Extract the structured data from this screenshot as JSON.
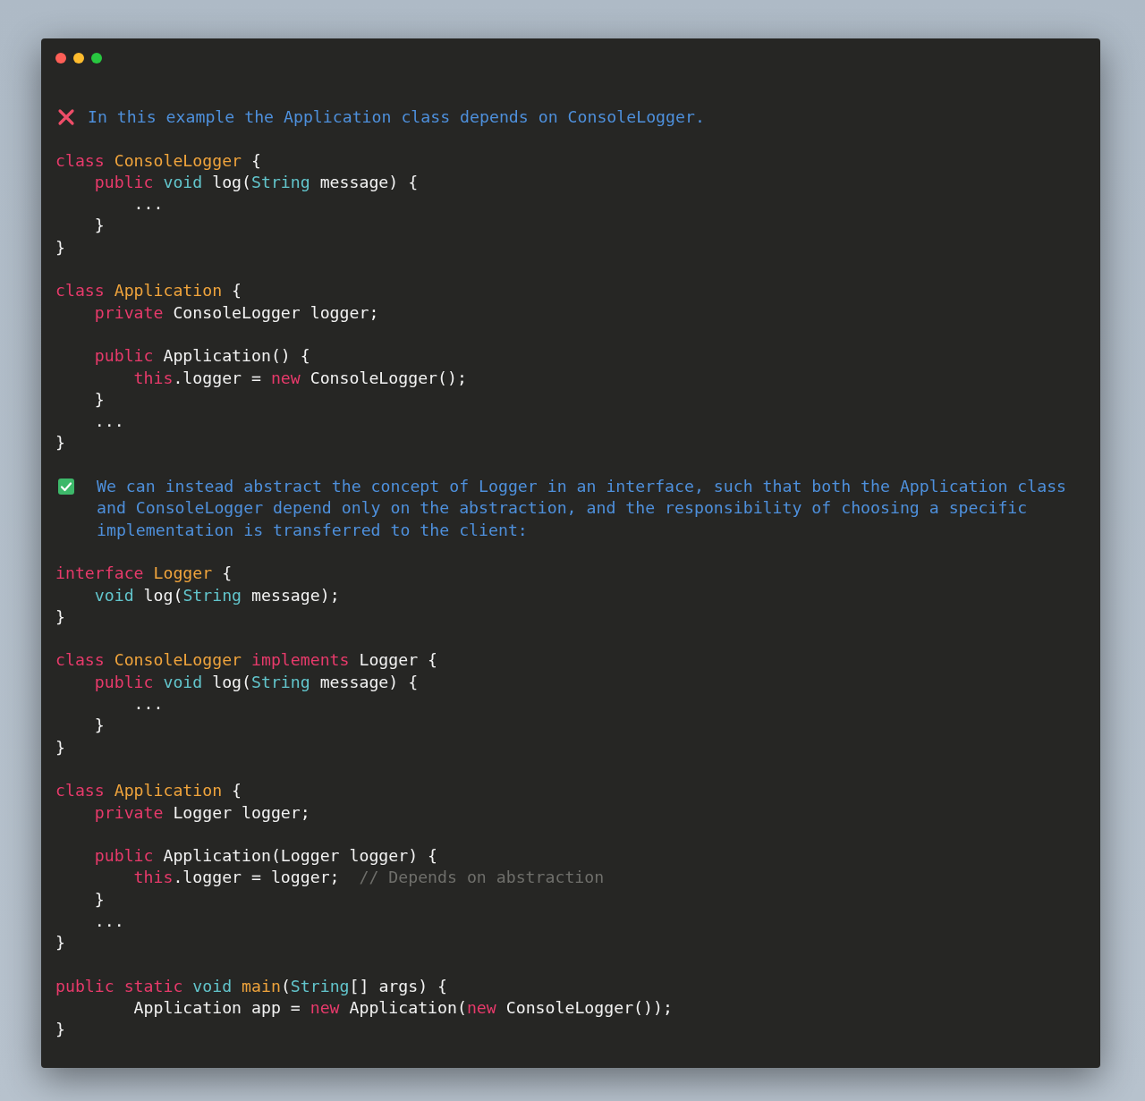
{
  "blocks": [
    {
      "kind": "error-note",
      "text": "In this example the Application class depends on ConsoleLogger."
    },
    {
      "kind": "code",
      "lines": [
        {
          "tokens": [
            {
              "kind": "keyword",
              "text": "class "
            },
            {
              "kind": "type",
              "text": "ConsoleLogger"
            },
            {
              "kind": "plain",
              "text": " {"
            }
          ]
        },
        {
          "tokens": [
            {
              "kind": "keyword",
              "text": "    public "
            },
            {
              "kind": "builtin",
              "text": "void "
            },
            {
              "kind": "plain",
              "text": "log("
            },
            {
              "kind": "builtin",
              "text": "String"
            },
            {
              "kind": "plain",
              "text": " message) {"
            }
          ]
        },
        {
          "tokens": [
            {
              "kind": "plain",
              "text": "        ..."
            }
          ]
        },
        {
          "tokens": [
            {
              "kind": "plain",
              "text": "    }"
            }
          ]
        },
        {
          "tokens": [
            {
              "kind": "plain",
              "text": "}"
            }
          ]
        }
      ]
    },
    {
      "kind": "code",
      "lines": [
        {
          "tokens": [
            {
              "kind": "keyword",
              "text": "class "
            },
            {
              "kind": "type",
              "text": "Application"
            },
            {
              "kind": "plain",
              "text": " {"
            }
          ]
        },
        {
          "tokens": [
            {
              "kind": "keyword",
              "text": "    private "
            },
            {
              "kind": "plain",
              "text": "ConsoleLogger logger;"
            }
          ]
        },
        {
          "kind": "blank"
        },
        {
          "tokens": [
            {
              "kind": "keyword",
              "text": "    public "
            },
            {
              "kind": "plain",
              "text": "Application() {"
            }
          ]
        },
        {
          "tokens": [
            {
              "kind": "keyword",
              "text": "        this"
            },
            {
              "kind": "plain",
              "text": ".logger = "
            },
            {
              "kind": "keyword",
              "text": "new "
            },
            {
              "kind": "plain",
              "text": "ConsoleLogger();"
            }
          ]
        },
        {
          "tokens": [
            {
              "kind": "plain",
              "text": "    }"
            }
          ]
        },
        {
          "tokens": [
            {
              "kind": "plain",
              "text": "    ..."
            }
          ]
        },
        {
          "tokens": [
            {
              "kind": "plain",
              "text": "}"
            }
          ]
        }
      ]
    },
    {
      "kind": "ok-note",
      "text": "We can instead abstract the concept of Logger in an interface, such that both the Application class and ConsoleLogger depend only on the abstraction, and the responsibility of choosing a specific implementation is transferred to the client:"
    },
    {
      "kind": "code",
      "lines": [
        {
          "tokens": [
            {
              "kind": "keyword",
              "text": "interface "
            },
            {
              "kind": "type",
              "text": "Logger"
            },
            {
              "kind": "plain",
              "text": " {"
            }
          ]
        },
        {
          "tokens": [
            {
              "kind": "builtin",
              "text": "    void "
            },
            {
              "kind": "plain",
              "text": "log("
            },
            {
              "kind": "builtin",
              "text": "String"
            },
            {
              "kind": "plain",
              "text": " message);"
            }
          ]
        },
        {
          "tokens": [
            {
              "kind": "plain",
              "text": "}"
            }
          ]
        }
      ]
    },
    {
      "kind": "code",
      "lines": [
        {
          "tokens": [
            {
              "kind": "keyword",
              "text": "class "
            },
            {
              "kind": "type",
              "text": "ConsoleLogger "
            },
            {
              "kind": "keyword",
              "text": "implements "
            },
            {
              "kind": "plain",
              "text": "Logger {"
            }
          ]
        },
        {
          "tokens": [
            {
              "kind": "keyword",
              "text": "    public "
            },
            {
              "kind": "builtin",
              "text": "void "
            },
            {
              "kind": "plain",
              "text": "log("
            },
            {
              "kind": "builtin",
              "text": "String"
            },
            {
              "kind": "plain",
              "text": " message) {"
            }
          ]
        },
        {
          "tokens": [
            {
              "kind": "plain",
              "text": "        ..."
            }
          ]
        },
        {
          "tokens": [
            {
              "kind": "plain",
              "text": "    }"
            }
          ]
        },
        {
          "tokens": [
            {
              "kind": "plain",
              "text": "}"
            }
          ]
        }
      ]
    },
    {
      "kind": "code",
      "lines": [
        {
          "tokens": [
            {
              "kind": "keyword",
              "text": "class "
            },
            {
              "kind": "type",
              "text": "Application"
            },
            {
              "kind": "plain",
              "text": " {"
            }
          ]
        },
        {
          "tokens": [
            {
              "kind": "keyword",
              "text": "    private "
            },
            {
              "kind": "plain",
              "text": "Logger logger;"
            }
          ]
        },
        {
          "kind": "blank"
        },
        {
          "tokens": [
            {
              "kind": "keyword",
              "text": "    public "
            },
            {
              "kind": "plain",
              "text": "Application(Logger logger) {"
            }
          ]
        },
        {
          "tokens": [
            {
              "kind": "keyword",
              "text": "        this"
            },
            {
              "kind": "plain",
              "text": ".logger = logger;  "
            },
            {
              "kind": "comment",
              "text": "// Depends on abstraction"
            }
          ]
        },
        {
          "tokens": [
            {
              "kind": "plain",
              "text": "    }"
            }
          ]
        },
        {
          "tokens": [
            {
              "kind": "plain",
              "text": "    ..."
            }
          ]
        },
        {
          "tokens": [
            {
              "kind": "plain",
              "text": "}"
            }
          ]
        }
      ]
    },
    {
      "kind": "code",
      "lines": [
        {
          "tokens": [
            {
              "kind": "keyword",
              "text": "public static "
            },
            {
              "kind": "builtin",
              "text": "void "
            },
            {
              "kind": "type",
              "text": "main"
            },
            {
              "kind": "plain",
              "text": "("
            },
            {
              "kind": "builtin",
              "text": "String"
            },
            {
              "kind": "plain",
              "text": "[] args) {"
            }
          ]
        },
        {
          "tokens": [
            {
              "kind": "plain",
              "text": "        Application app = "
            },
            {
              "kind": "keyword",
              "text": "new "
            },
            {
              "kind": "plain",
              "text": "Application("
            },
            {
              "kind": "keyword",
              "text": "new "
            },
            {
              "kind": "plain",
              "text": "ConsoleLogger());"
            }
          ]
        },
        {
          "tokens": [
            {
              "kind": "plain",
              "text": "}"
            }
          ]
        }
      ]
    }
  ]
}
